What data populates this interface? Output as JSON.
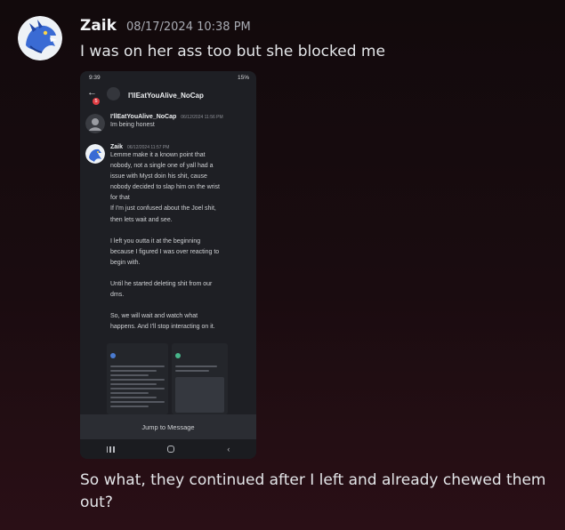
{
  "post": {
    "username": "Zaik",
    "timestamp": "08/17/2024 10:38 PM",
    "message1": "I was on her ass too but she blocked me",
    "message2": "So what, they continued after I left and already chewed them out?"
  },
  "screenshot": {
    "status_time": "9:39",
    "status_battery": "15%",
    "badge": "5",
    "channel_title": "I'llEatYouAlive_NoCap",
    "msg1": {
      "author": "I'llEatYouAlive_NoCap",
      "time": "06/12/2024 11:56 PM",
      "text": "Im being honest"
    },
    "msg2": {
      "author": "Zaik",
      "time": "06/12/2024 11:57 PM",
      "lines": [
        "Lemme make it a known point that",
        "nobody, not a single one of yall had a",
        "issue with Myst doin his shit, cause",
        "nobody decided to slap him on the wrist",
        "for that",
        "If I'm just confused about the Joel shit,",
        "then lets wait and see.",
        "",
        "I left you outta it at the beginning",
        "because I figured I was over reacting to",
        "begin with.",
        "",
        "Until he started deleting shit from our",
        "dms.",
        "",
        "So, we will wait and watch what",
        "happens. And I'll stop interacting on it."
      ]
    },
    "jump_label": "Jump to Message",
    "icons": {
      "back": "arrow-left-icon",
      "recent": "recent-apps-icon",
      "home": "home-icon",
      "nav_back": "chevron-left-icon"
    }
  }
}
